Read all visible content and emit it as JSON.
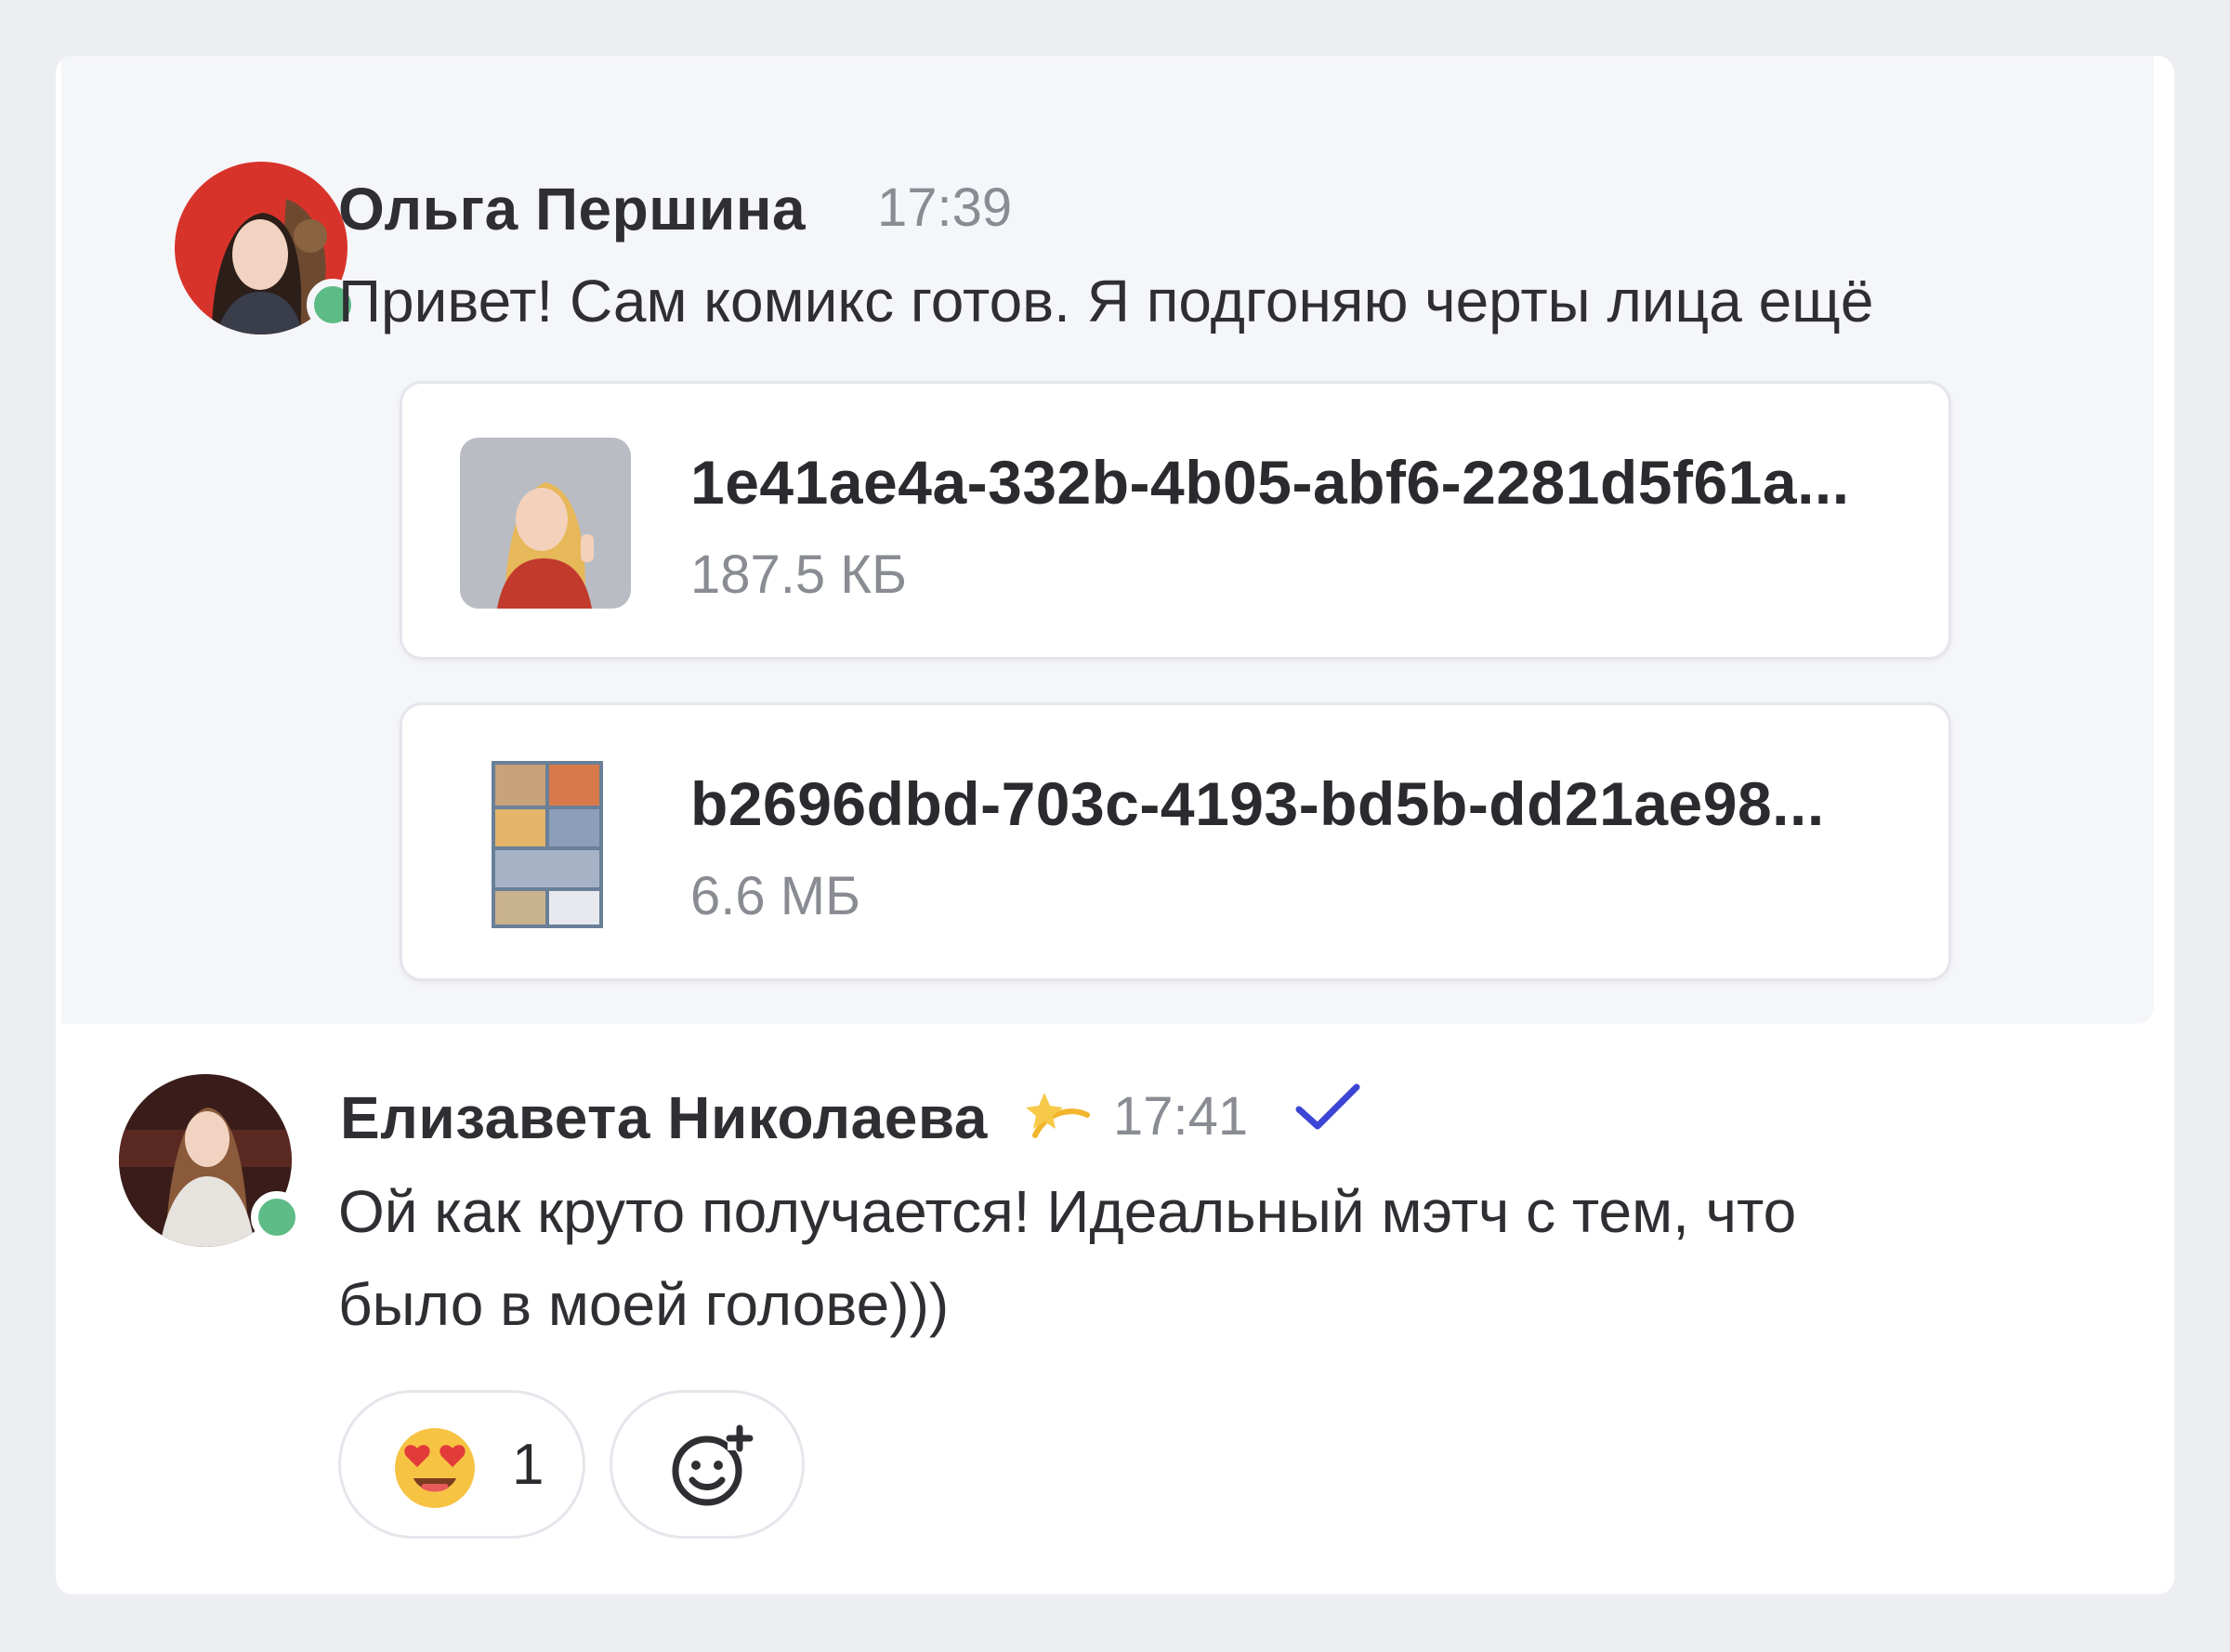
{
  "messages": [
    {
      "author": "Ольга Першина",
      "time": "17:39",
      "text": "Привет! Сам комикс готов. Я подгоняю черты лица ещё",
      "online": true,
      "attachments": [
        {
          "name": "1e41ae4a-332b-4b05-abf6-2281d5f61a...",
          "size": "187.5 КБ"
        },
        {
          "name": "b2696dbd-703c-4193-bd5b-dd21ae98...",
          "size": "6.6 МБ"
        }
      ]
    },
    {
      "author": "Елизавета Николаева",
      "status_emoji": "dizzy-star-icon",
      "time": "17:41",
      "read": true,
      "text_line1": "Ой как круто получается! Идеальный мэтч с тем, что",
      "text_line2": "было в моей голове)))",
      "online": true,
      "reactions": [
        {
          "emoji": "heart-eyes-emoji",
          "count": "1"
        }
      ]
    }
  ],
  "colors": {
    "online": "#5dbb86",
    "read_check": "#3d45d6",
    "secondary_text": "#8a8c93",
    "hover_bg": "#f5f6fa"
  }
}
